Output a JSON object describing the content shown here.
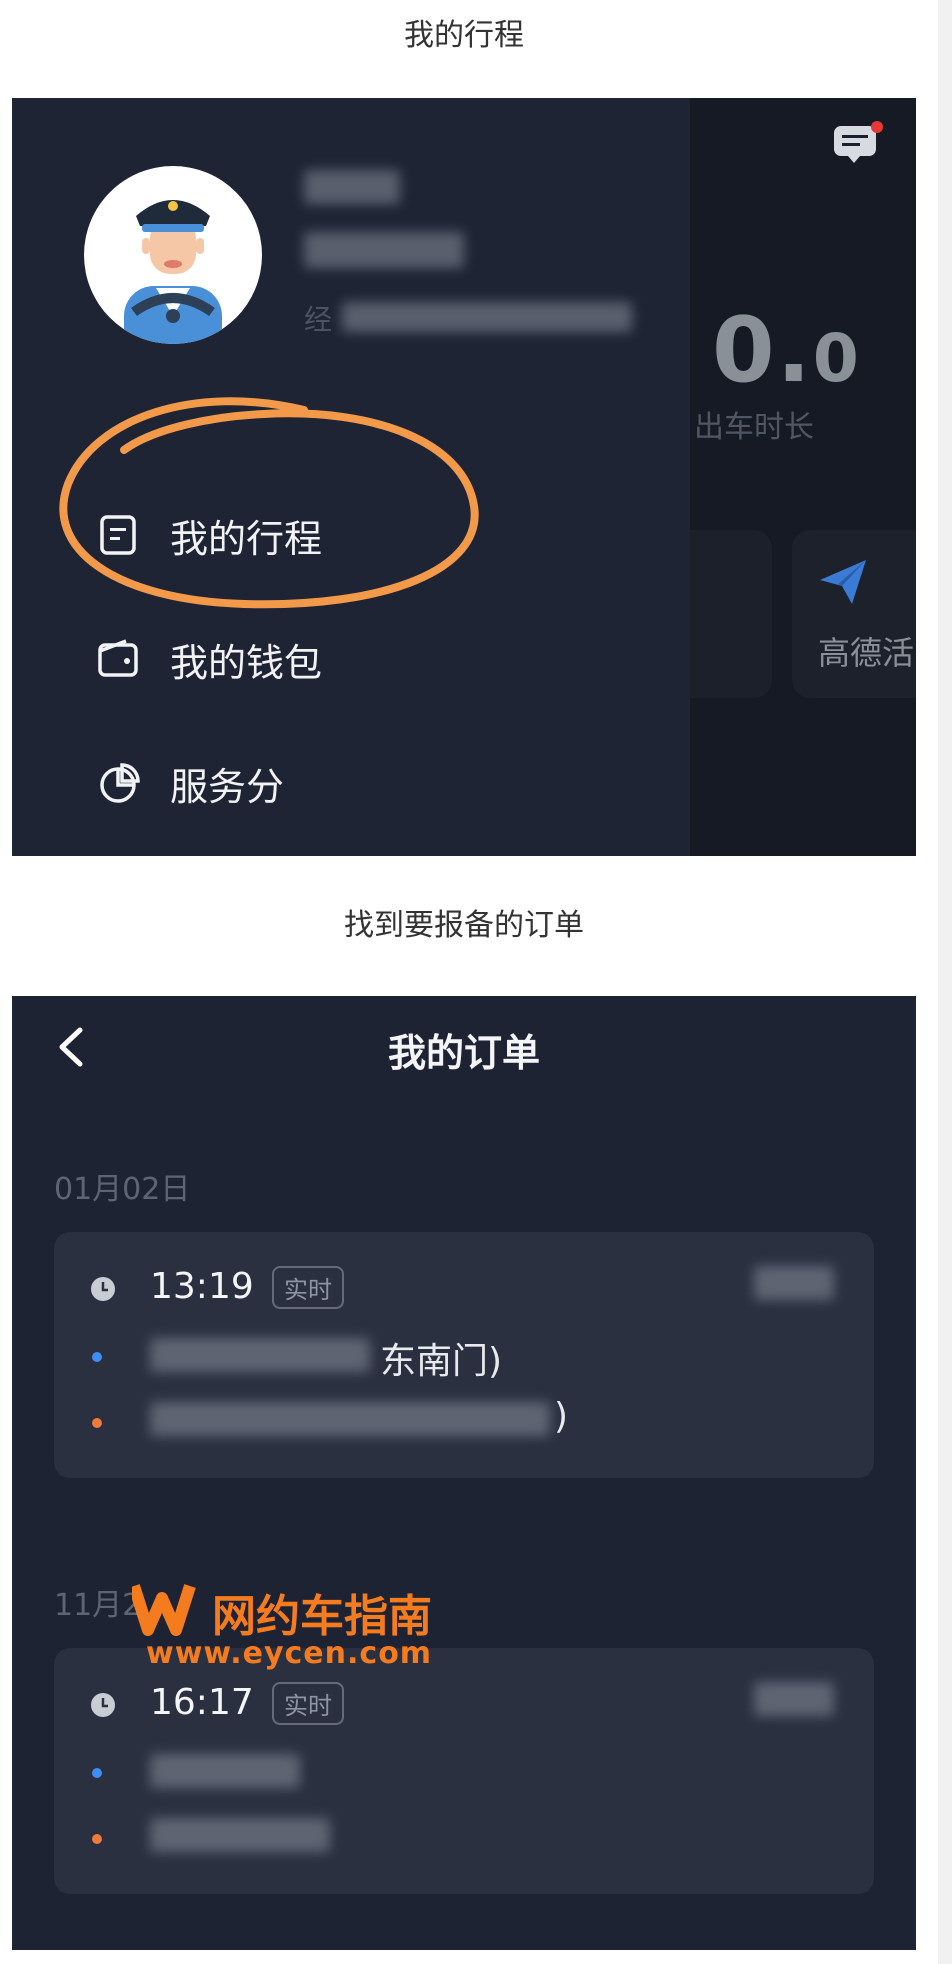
{
  "captions": {
    "first": "我的行程",
    "second": "找到要报备的订单"
  },
  "screen1": {
    "name_prefix": "经",
    "drawer_items": [
      {
        "label": "我的行程",
        "icon": "document-icon"
      },
      {
        "label": "我的钱包",
        "icon": "wallet-icon"
      },
      {
        "label": "服务分",
        "icon": "pie-chart-icon"
      }
    ],
    "stat_value_int": "0.",
    "stat_value_dec": "0",
    "stat_label": "出车时长",
    "gaode_label": "高德活",
    "highlight_color": "#f29a4a"
  },
  "screen2": {
    "title": "我的订单",
    "orders": [
      {
        "date": "01月02日",
        "time": "13:19",
        "badge": "实时",
        "from_suffix": "东南门)",
        "to_suffix": ")"
      },
      {
        "date": "11月2",
        "time": "16:17",
        "badge": "实时"
      }
    ]
  },
  "watermark": {
    "title": "网约车指南",
    "url": "www.eycen.com",
    "color": "#f57b1f"
  }
}
